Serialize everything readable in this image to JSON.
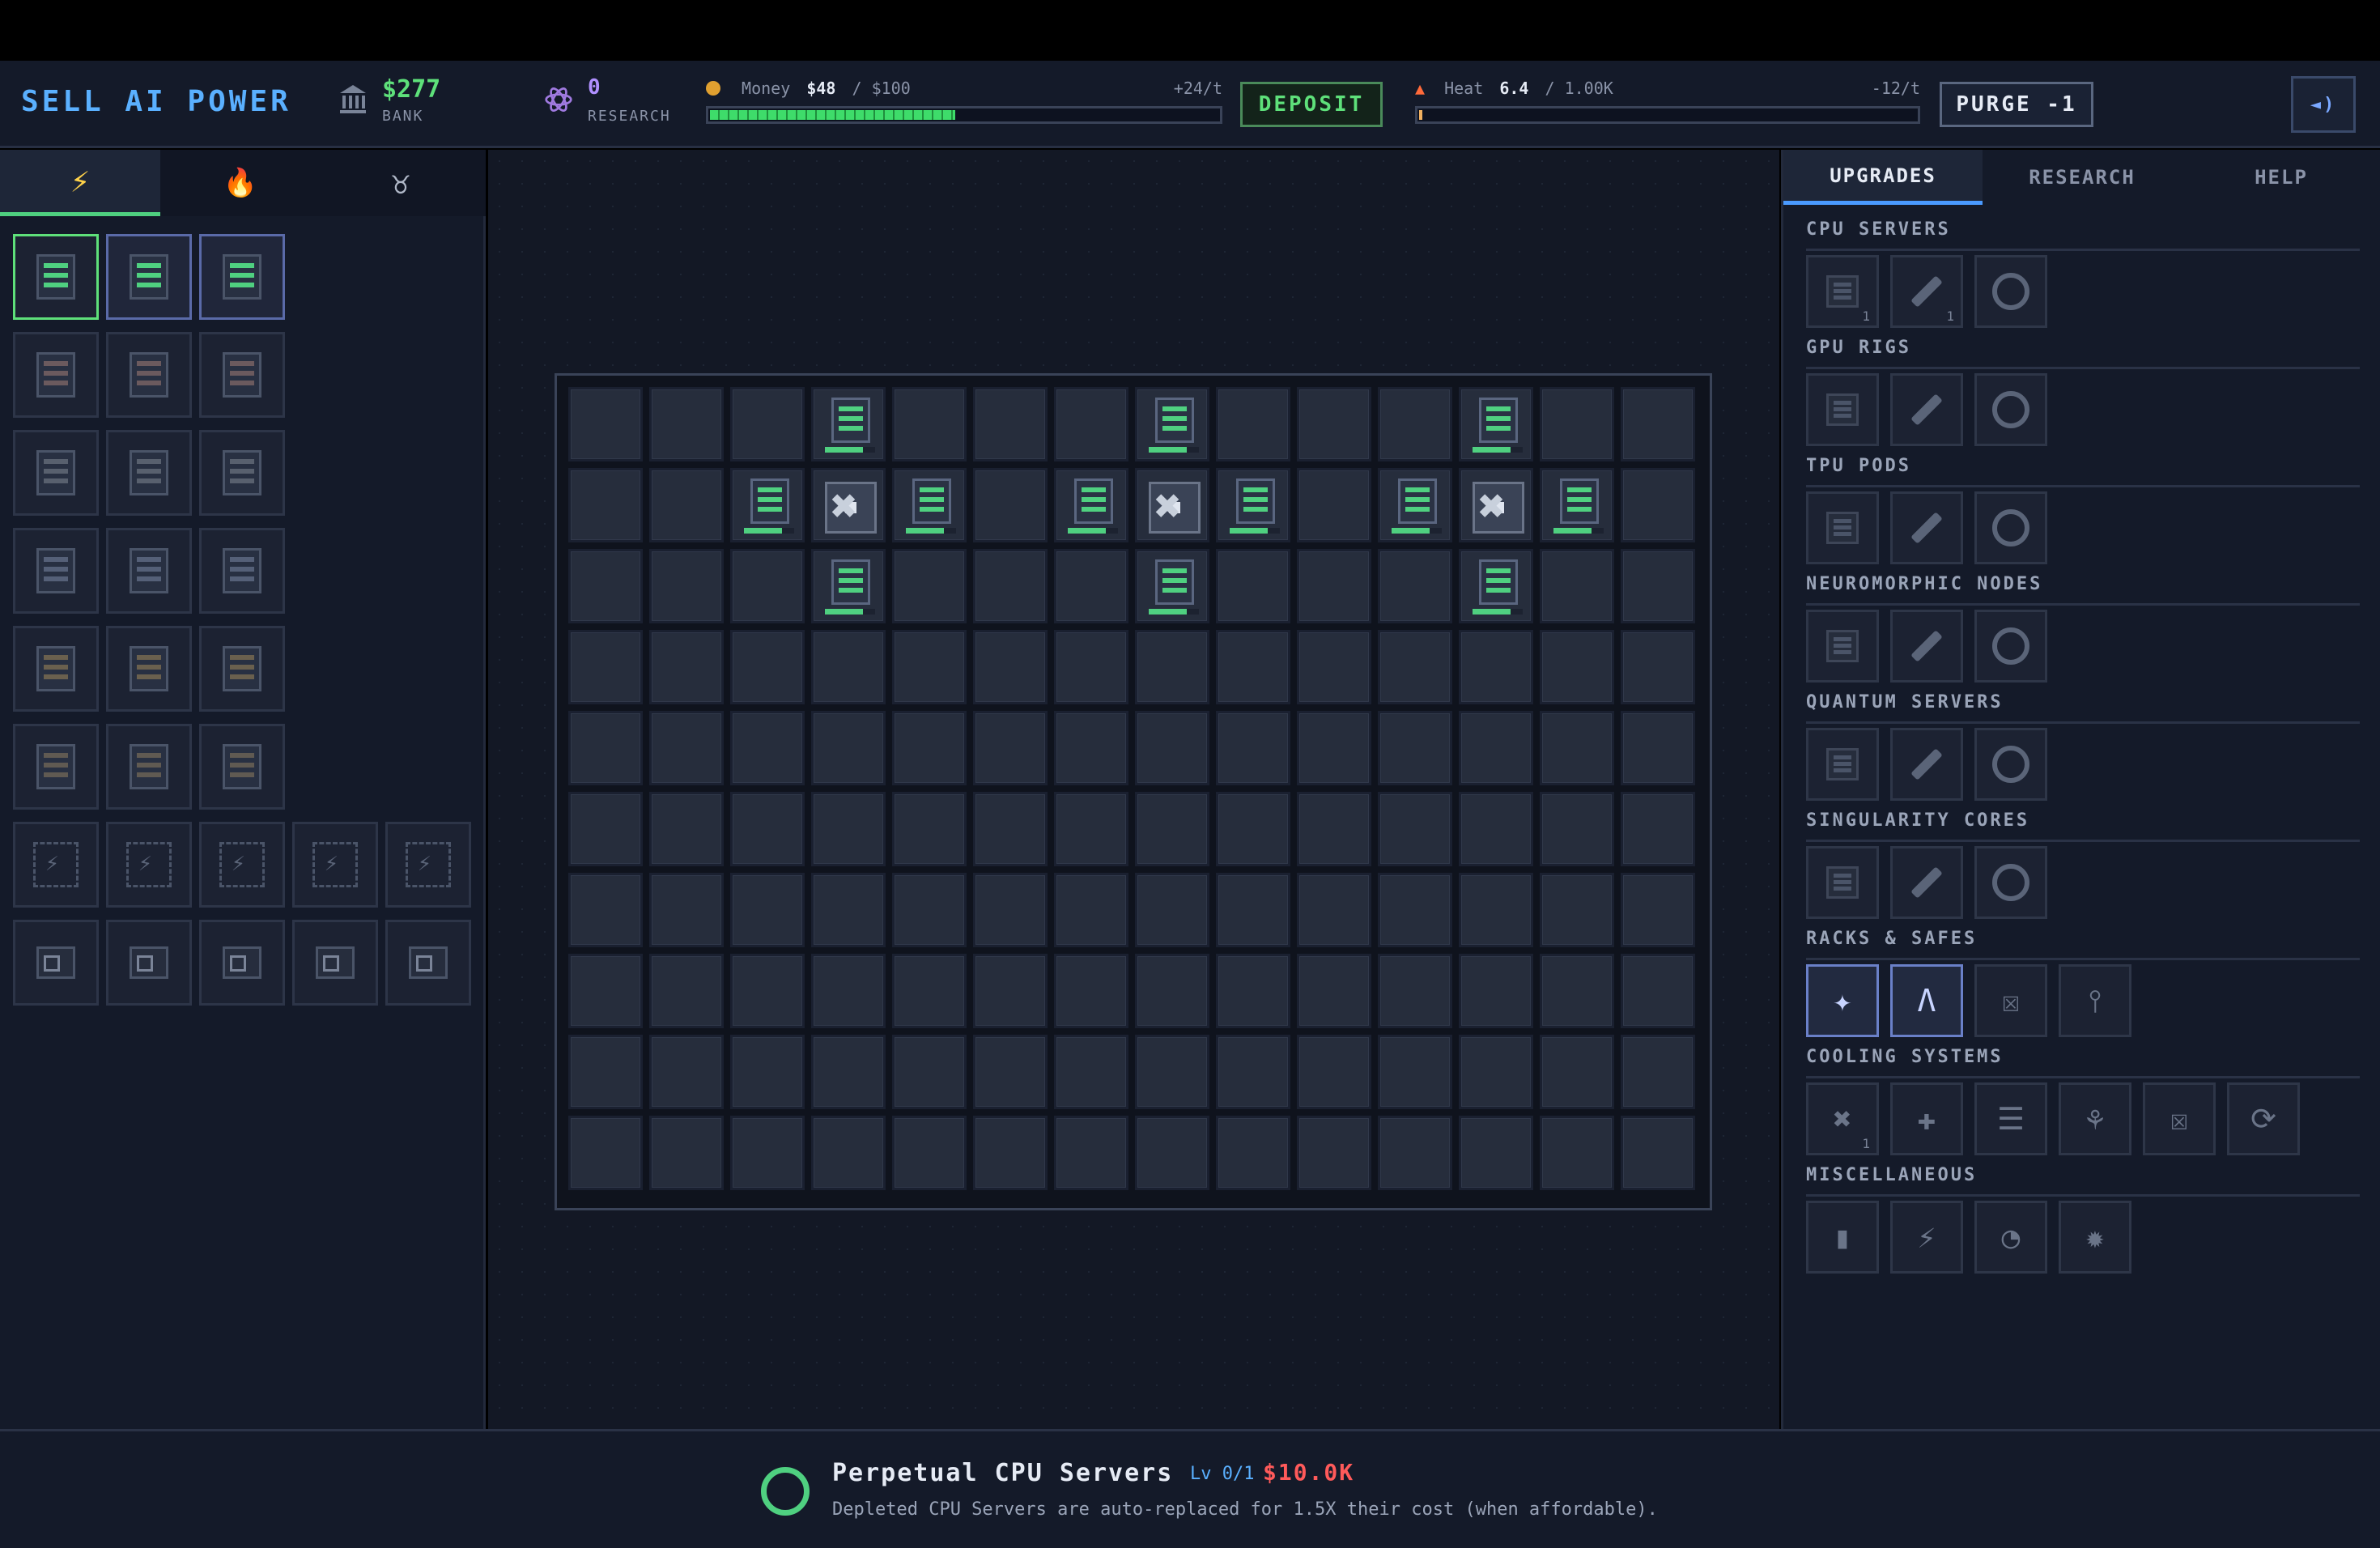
{
  "header": {
    "title": "SELL AI POWER",
    "bank_value": "$277",
    "bank_label": "BANK",
    "research_value": "0",
    "research_label": "RESEARCH",
    "money_label": "Money",
    "money_value": "$48",
    "money_max": "/ $100",
    "money_rate": "+24/t",
    "money_fraction": 0.48,
    "deposit_label": "DEPOSIT",
    "heat_label": "Heat",
    "heat_value": "6.4",
    "heat_max": "/ 1.00K",
    "heat_rate": "-12/t",
    "heat_fraction": 0.0064,
    "purge_label": "PURGE -1",
    "sound_icon": "speaker-icon"
  },
  "left_tabs": [
    {
      "name": "power",
      "icon": "lightning-icon",
      "glyph": "⚡",
      "active": true
    },
    {
      "name": "heat",
      "icon": "flame-icon",
      "glyph": "🔥",
      "active": false
    },
    {
      "name": "special",
      "icon": "symbol-icon",
      "glyph": "♉",
      "active": false
    }
  ],
  "right_tabs": [
    {
      "label": "UPGRADES",
      "active": true
    },
    {
      "label": "RESEARCH",
      "active": false
    },
    {
      "label": "HELP",
      "active": false
    }
  ],
  "upgrade_sections": [
    {
      "title": "CPU SERVERS"
    },
    {
      "title": "GPU RIGS"
    },
    {
      "title": "TPU PODS"
    },
    {
      "title": "NEUROMORPHIC NODES"
    },
    {
      "title": "QUANTUM SERVERS"
    },
    {
      "title": "SINGULARITY CORES"
    },
    {
      "title": "RACKS & SAFES"
    },
    {
      "title": "COOLING SYSTEMS"
    },
    {
      "title": "MISCELLANEOUS"
    }
  ],
  "upgrade_levels": {
    "cpu_server": "1",
    "cpu_wrench": "1",
    "cooling_first": "1"
  },
  "grid": {
    "cols": 14,
    "rows": 10,
    "cells": [
      {
        "r": 0,
        "c": 3,
        "type": "server"
      },
      {
        "r": 0,
        "c": 7,
        "type": "server"
      },
      {
        "r": 0,
        "c": 11,
        "type": "server"
      },
      {
        "r": 1,
        "c": 2,
        "type": "server"
      },
      {
        "r": 1,
        "c": 3,
        "type": "fan"
      },
      {
        "r": 1,
        "c": 4,
        "type": "server"
      },
      {
        "r": 1,
        "c": 6,
        "type": "server"
      },
      {
        "r": 1,
        "c": 7,
        "type": "fan"
      },
      {
        "r": 1,
        "c": 8,
        "type": "server"
      },
      {
        "r": 1,
        "c": 10,
        "type": "server"
      },
      {
        "r": 1,
        "c": 11,
        "type": "fan"
      },
      {
        "r": 1,
        "c": 12,
        "type": "server"
      },
      {
        "r": 2,
        "c": 3,
        "type": "server"
      },
      {
        "r": 2,
        "c": 7,
        "type": "server"
      },
      {
        "r": 2,
        "c": 11,
        "type": "server"
      }
    ]
  },
  "info": {
    "title": "Perpetual CPU Servers",
    "level": "Lv 0/1",
    "cost": "$10.0K",
    "description": "Depleted CPU Servers are auto-replaced for 1.5X their cost (when affordable)."
  },
  "colors": {
    "accent_green": "#4fd080",
    "accent_blue": "#5ab0ff",
    "cost_red": "#ff5a5a"
  }
}
